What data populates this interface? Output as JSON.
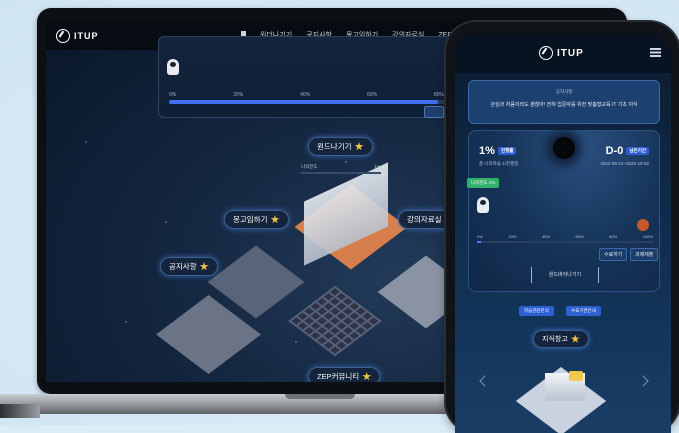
{
  "laptop": {
    "logo": "ITUP",
    "nav_items": [
      "원더나기기",
      "공지사항",
      "몽고임하기",
      "강의자료실",
      "ZEP 커뮤니티"
    ],
    "progress_ticks": [
      "0%",
      "20%",
      "40%",
      "60%",
      "80%"
    ],
    "progress_value": 0.96,
    "rooms": {
      "center": "원드나기기",
      "left_upper": "몽고임하기",
      "left_lower": "공지사항",
      "right": "강의자료실",
      "bottom": "ZEP커뮤니티"
    },
    "center_bar_left": "나의진도",
    "center_bar_right": "1%"
  },
  "phone": {
    "logo": "ITUP",
    "notice_label": "공지사항",
    "notice_text": "관심과 처음이라도 괜찮아! 전혀 입문자를 위한 맞춤형교육 IT 기초 지식",
    "progress_percent": "1%",
    "progress_badge": "진행률",
    "progress_sub": "총 나의학습 1/진행중",
    "dday": "D-0",
    "dday_badge": "남은기간",
    "dday_sub": "2022-08-12~2022-10-02",
    "my_progress_tag": "나의진도 1%",
    "ticks": [
      "0%",
      "20%",
      "40%",
      "60%",
      "80%",
      "100%"
    ],
    "progress_value": 0.01,
    "btn_left": "수료하기",
    "btn_right": "과제제출",
    "room_link": "원드바이나기기",
    "pill_left": "학습관련문의",
    "pill_right": "수료기관안내",
    "section_title": "지식창고"
  }
}
